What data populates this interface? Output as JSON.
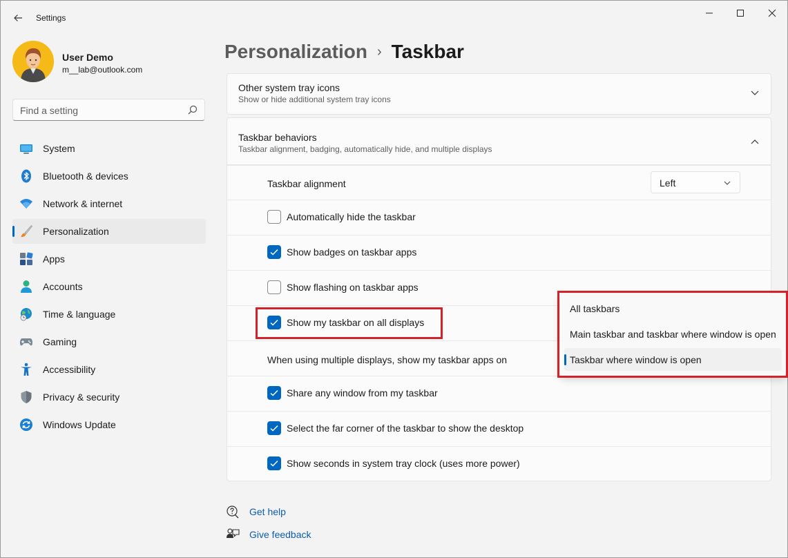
{
  "window": {
    "app_title": "Settings",
    "controls": {
      "minimize": "minimize",
      "maximize": "maximize",
      "close": "close"
    }
  },
  "user": {
    "name": "User Demo",
    "email": "m__lab@outlook.com"
  },
  "search": {
    "placeholder": "Find a setting"
  },
  "sidebar": {
    "items": [
      {
        "label": "System",
        "icon": "monitor-icon"
      },
      {
        "label": "Bluetooth & devices",
        "icon": "bluetooth-icon"
      },
      {
        "label": "Network & internet",
        "icon": "wifi-icon"
      },
      {
        "label": "Personalization",
        "icon": "brush-icon",
        "active": true
      },
      {
        "label": "Apps",
        "icon": "apps-icon"
      },
      {
        "label": "Accounts",
        "icon": "person-icon"
      },
      {
        "label": "Time & language",
        "icon": "globe-clock-icon"
      },
      {
        "label": "Gaming",
        "icon": "gamepad-icon"
      },
      {
        "label": "Accessibility",
        "icon": "accessibility-icon"
      },
      {
        "label": "Privacy & security",
        "icon": "shield-icon"
      },
      {
        "label": "Windows Update",
        "icon": "update-icon"
      }
    ]
  },
  "breadcrumb": {
    "parent": "Personalization",
    "separator": "›",
    "current": "Taskbar"
  },
  "sections": {
    "tray_icons": {
      "title": "Other system tray icons",
      "subtitle": "Show or hide additional system tray icons"
    },
    "behaviors": {
      "title": "Taskbar behaviors",
      "subtitle": "Taskbar alignment, badging, automatically hide, and multiple displays"
    }
  },
  "behaviors": {
    "alignment_label": "Taskbar alignment",
    "alignment_value": "Left",
    "auto_hide": {
      "label": "Automatically hide the taskbar",
      "checked": false
    },
    "badges": {
      "label": "Show badges on taskbar apps",
      "checked": true
    },
    "flashing": {
      "label": "Show flashing on taskbar apps",
      "checked": false
    },
    "all_displays": {
      "label": "Show my taskbar on all displays",
      "checked": true
    },
    "multi_display_label": "When using multiple displays, show my taskbar apps on",
    "share_window": {
      "label": "Share any window from my taskbar",
      "checked": true
    },
    "far_corner": {
      "label": "Select the far corner of the taskbar to show the desktop",
      "checked": true
    },
    "seconds": {
      "label": "Show seconds in system tray clock (uses more power)",
      "checked": true
    }
  },
  "flyout": {
    "options": [
      "All taskbars",
      "Main taskbar and taskbar where window is open",
      "Taskbar where window is open"
    ],
    "selected_index": 2
  },
  "footer": {
    "help": "Get help",
    "feedback": "Give feedback"
  },
  "colors": {
    "accent": "#0067c0",
    "highlight": "#d1232a",
    "link": "#0b5cad"
  }
}
